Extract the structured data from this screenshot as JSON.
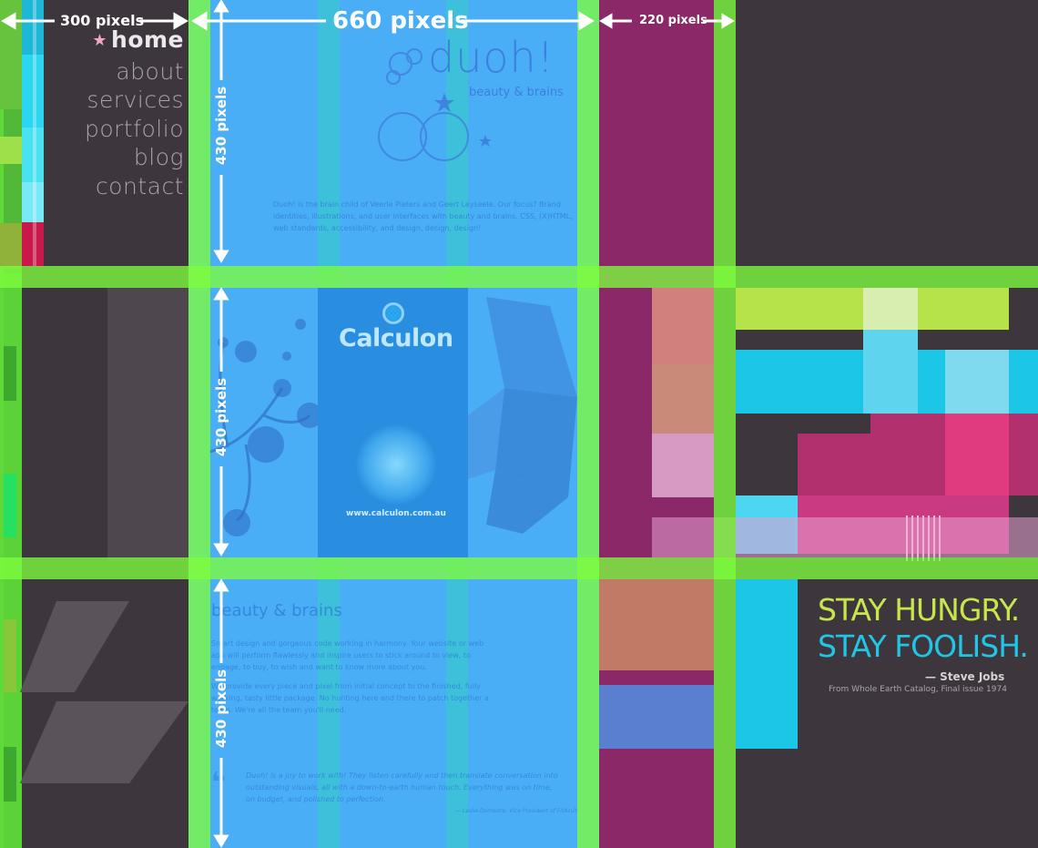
{
  "measurements": {
    "left_width": "300 pixels",
    "main_width": "660 pixels",
    "right_width": "220 pixels",
    "row_height_1": "430 pixels",
    "row_height_2": "430 pixels",
    "row_height_3": "430 pixels"
  },
  "nav": {
    "items": [
      {
        "label": "home"
      },
      {
        "label": "about"
      },
      {
        "label": "services"
      },
      {
        "label": "portfolio"
      },
      {
        "label": "blog"
      },
      {
        "label": "contact"
      }
    ],
    "active_marker": "★"
  },
  "duoh": {
    "logo": "duoh!",
    "tagline": "beauty & brains",
    "intro": "Duoh! is the brain child of Veerle Pieters and Geert Leyseele. Our focus? Brand identities, illustrations, and user interfaces with beauty and brains. CSS, (X)HTML, web standards, accessibility, and design, design, design!"
  },
  "calculon": {
    "title": "Calculon",
    "url": "www.calculon.com.au"
  },
  "services": {
    "heading": "beauty & brains",
    "paragraph_1": "Smart design and gorgeous code working in harmony. Your website or web app will perform flawlessly and inspire users to stick around to view, to engage, to buy, to wish and want to know more about you.",
    "paragraph_2": "We provide every piece and pixel from initial concept to the finished, fully working, tasty little package. No hunting here and there to patch together a team. We're all the team you'll need."
  },
  "testimonial": {
    "quote": "Duoh! is a joy to work with! They listen carefully and then translate conversation into outstanding visuals, all with a down-to-earth human touch. Everything was on time, on budget, and polished to perfection.",
    "credit": "— Leslie Domeshe, Vice President of FitAcult"
  },
  "stay": {
    "line1": "STAY HUNGRY.",
    "line2": "STAY FOOLISH.",
    "attribution": "— Steve Jobs",
    "source": "From Whole Earth Catalog, Final issue 1974"
  },
  "colors": {
    "background": "#3d373d",
    "grid_green": "#7dfc3d",
    "column_blue": "#4aaef6",
    "column_cyan": "#3bc4d6",
    "magenta": "#8a2868",
    "stay_green": "#c8e64a",
    "stay_cyan": "#20c6e6"
  }
}
